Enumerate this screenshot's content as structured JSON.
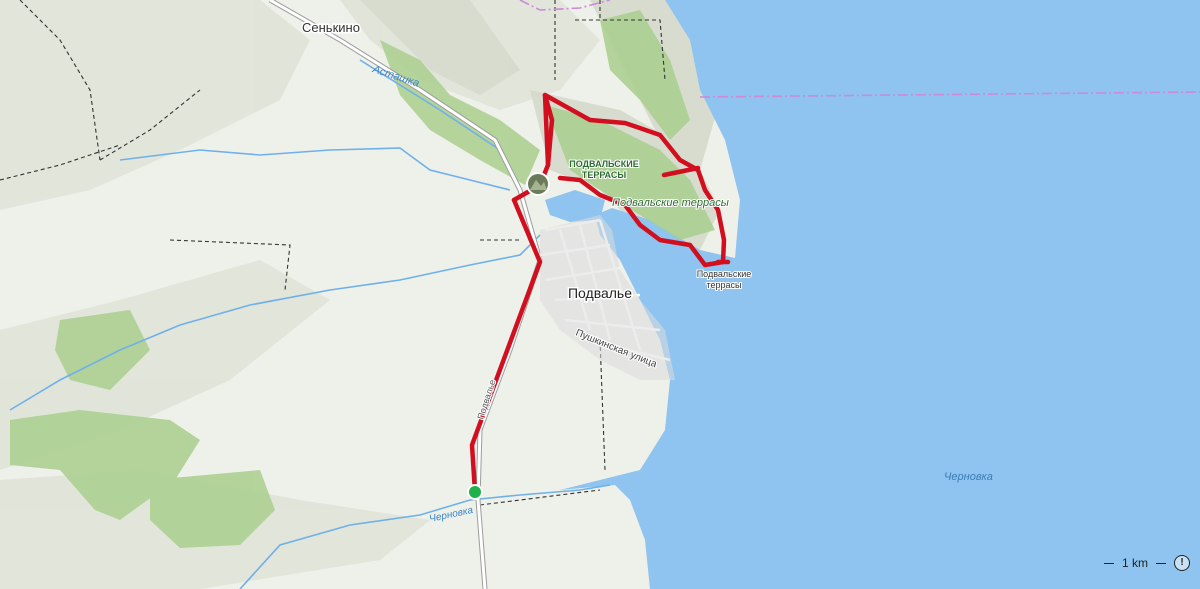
{
  "map": {
    "labels": {
      "village_north": "Сенькино",
      "village_main": "Подвалье",
      "river_north": "Асташка",
      "river_south": "Черновка",
      "sea_label": "Черновка",
      "terraces_area_1": "ПОДВАЛЬСКИЕ",
      "terraces_area_2": "ТЕРРАСЫ",
      "terraces_italic": "Подвальские террасы",
      "terraces_point_1": "Подвальские",
      "terraces_point_2": "террасы",
      "street": "Пушкинская улица",
      "road": "Подвалье"
    },
    "colors": {
      "water": "#8ec4ef",
      "land": "#eef0ea",
      "forest": "#a9cf8e",
      "route": "#d10f1f",
      "start_marker": "#21b14a",
      "river": "#6fb0ea"
    },
    "icons": {
      "start": "green-dot-icon",
      "waypoint": "photo-marker-icon"
    }
  },
  "scale": {
    "label": "1 km"
  },
  "controls": {
    "info_symbol": "!"
  }
}
